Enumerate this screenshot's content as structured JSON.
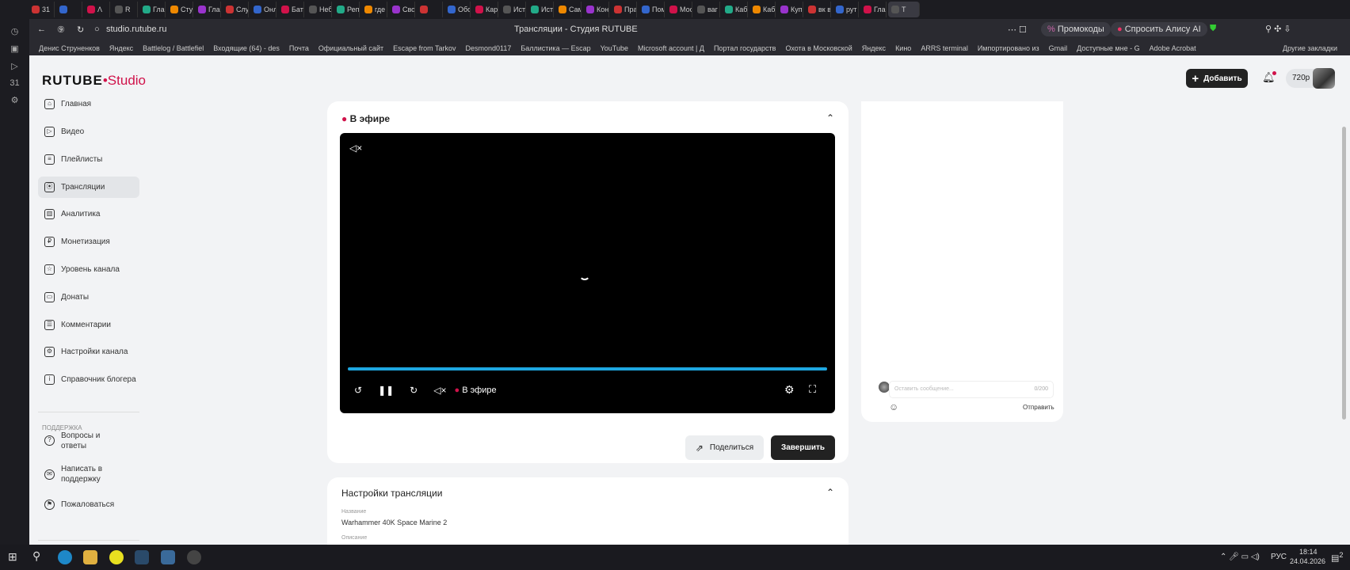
{
  "browser": {
    "tabs": [
      "31",
      "",
      "Λ",
      "R",
      "Глав",
      "Сту",
      "Глав",
      "Слу",
      "Онл",
      "Бат",
      "Неб",
      "Реп",
      "где",
      "Сво",
      "",
      "Обо",
      "Кар",
      "Ист",
      "Ист",
      "Сам",
      "Кон",
      "Пра",
      "Пом",
      "Мос",
      "ваг",
      "Каб",
      "Каб",
      "Куп",
      "вк в",
      "рут",
      "Глав",
      "Т"
    ],
    "url": "studio.rutube.ru",
    "page_title": "Трансляции - Студия RUTUBE",
    "promo_label": "Промокоды",
    "alice_label": "Спросить Алису AI",
    "bookmarks": [
      "Денис Струненков",
      "Яндекс",
      "Battlelog / Battlefiel",
      "Входящие (64) - des",
      "Почта",
      "Официальный сайт",
      "Escape from Tarkov",
      "Desmond0117",
      "Баллистика — Escap",
      "YouTube",
      "Microsoft account | Д",
      "Портал государств",
      "Охота в Московской",
      "Яндекс",
      "Кино",
      "ARRS terminal",
      "Импортировано из",
      "Gmail",
      "Доступные мне - G",
      "Adobe Acrobat"
    ],
    "other_bookmarks": "Другие закладки"
  },
  "header": {
    "logo": "RUTUBE",
    "logo_studio": "Studio",
    "add_label": "Добавить",
    "quality": "720p"
  },
  "sidebar": {
    "items": [
      {
        "label": "Главная",
        "icon": "home-icon"
      },
      {
        "label": "Видео",
        "icon": "video-icon"
      },
      {
        "label": "Плейлисты",
        "icon": "playlist-icon"
      },
      {
        "label": "Трансляции",
        "icon": "broadcast-icon"
      },
      {
        "label": "Аналитика",
        "icon": "analytics-icon"
      },
      {
        "label": "Монетизация",
        "icon": "ruble-icon"
      },
      {
        "label": "Уровень канала",
        "icon": "star-icon"
      },
      {
        "label": "Донаты",
        "icon": "wallet-icon"
      },
      {
        "label": "Комментарии",
        "icon": "comment-icon"
      },
      {
        "label": "Настройки канала",
        "icon": "gear-icon"
      },
      {
        "label": "Справочник блогера",
        "icon": "info-icon"
      }
    ],
    "support_heading": "ПОДДЕРЖКА",
    "support": [
      {
        "label": "Вопросы и ответы"
      },
      {
        "label": "Написать в поддержку"
      },
      {
        "label": "Пожаловаться"
      }
    ]
  },
  "live": {
    "title": "В эфире",
    "player_live": "В эфире",
    "progress": 1.0,
    "share_label": "Поделиться",
    "finish_label": "Завершить"
  },
  "settings": {
    "title": "Настройки трансляции",
    "name_label": "Название",
    "name_value": "Warhammer 40K Space Marine 2",
    "desc_label": "Описание"
  },
  "chat": {
    "placeholder": "Оставить сообщение...",
    "counter": "0/200",
    "send_label": "Отправить"
  },
  "taskbar": {
    "lang": "РУС",
    "time": "18:14",
    "date": "24.04.2026",
    "notif": "2"
  },
  "colors": {
    "accent": "#d0124a",
    "progress": "#1ea7e1"
  }
}
